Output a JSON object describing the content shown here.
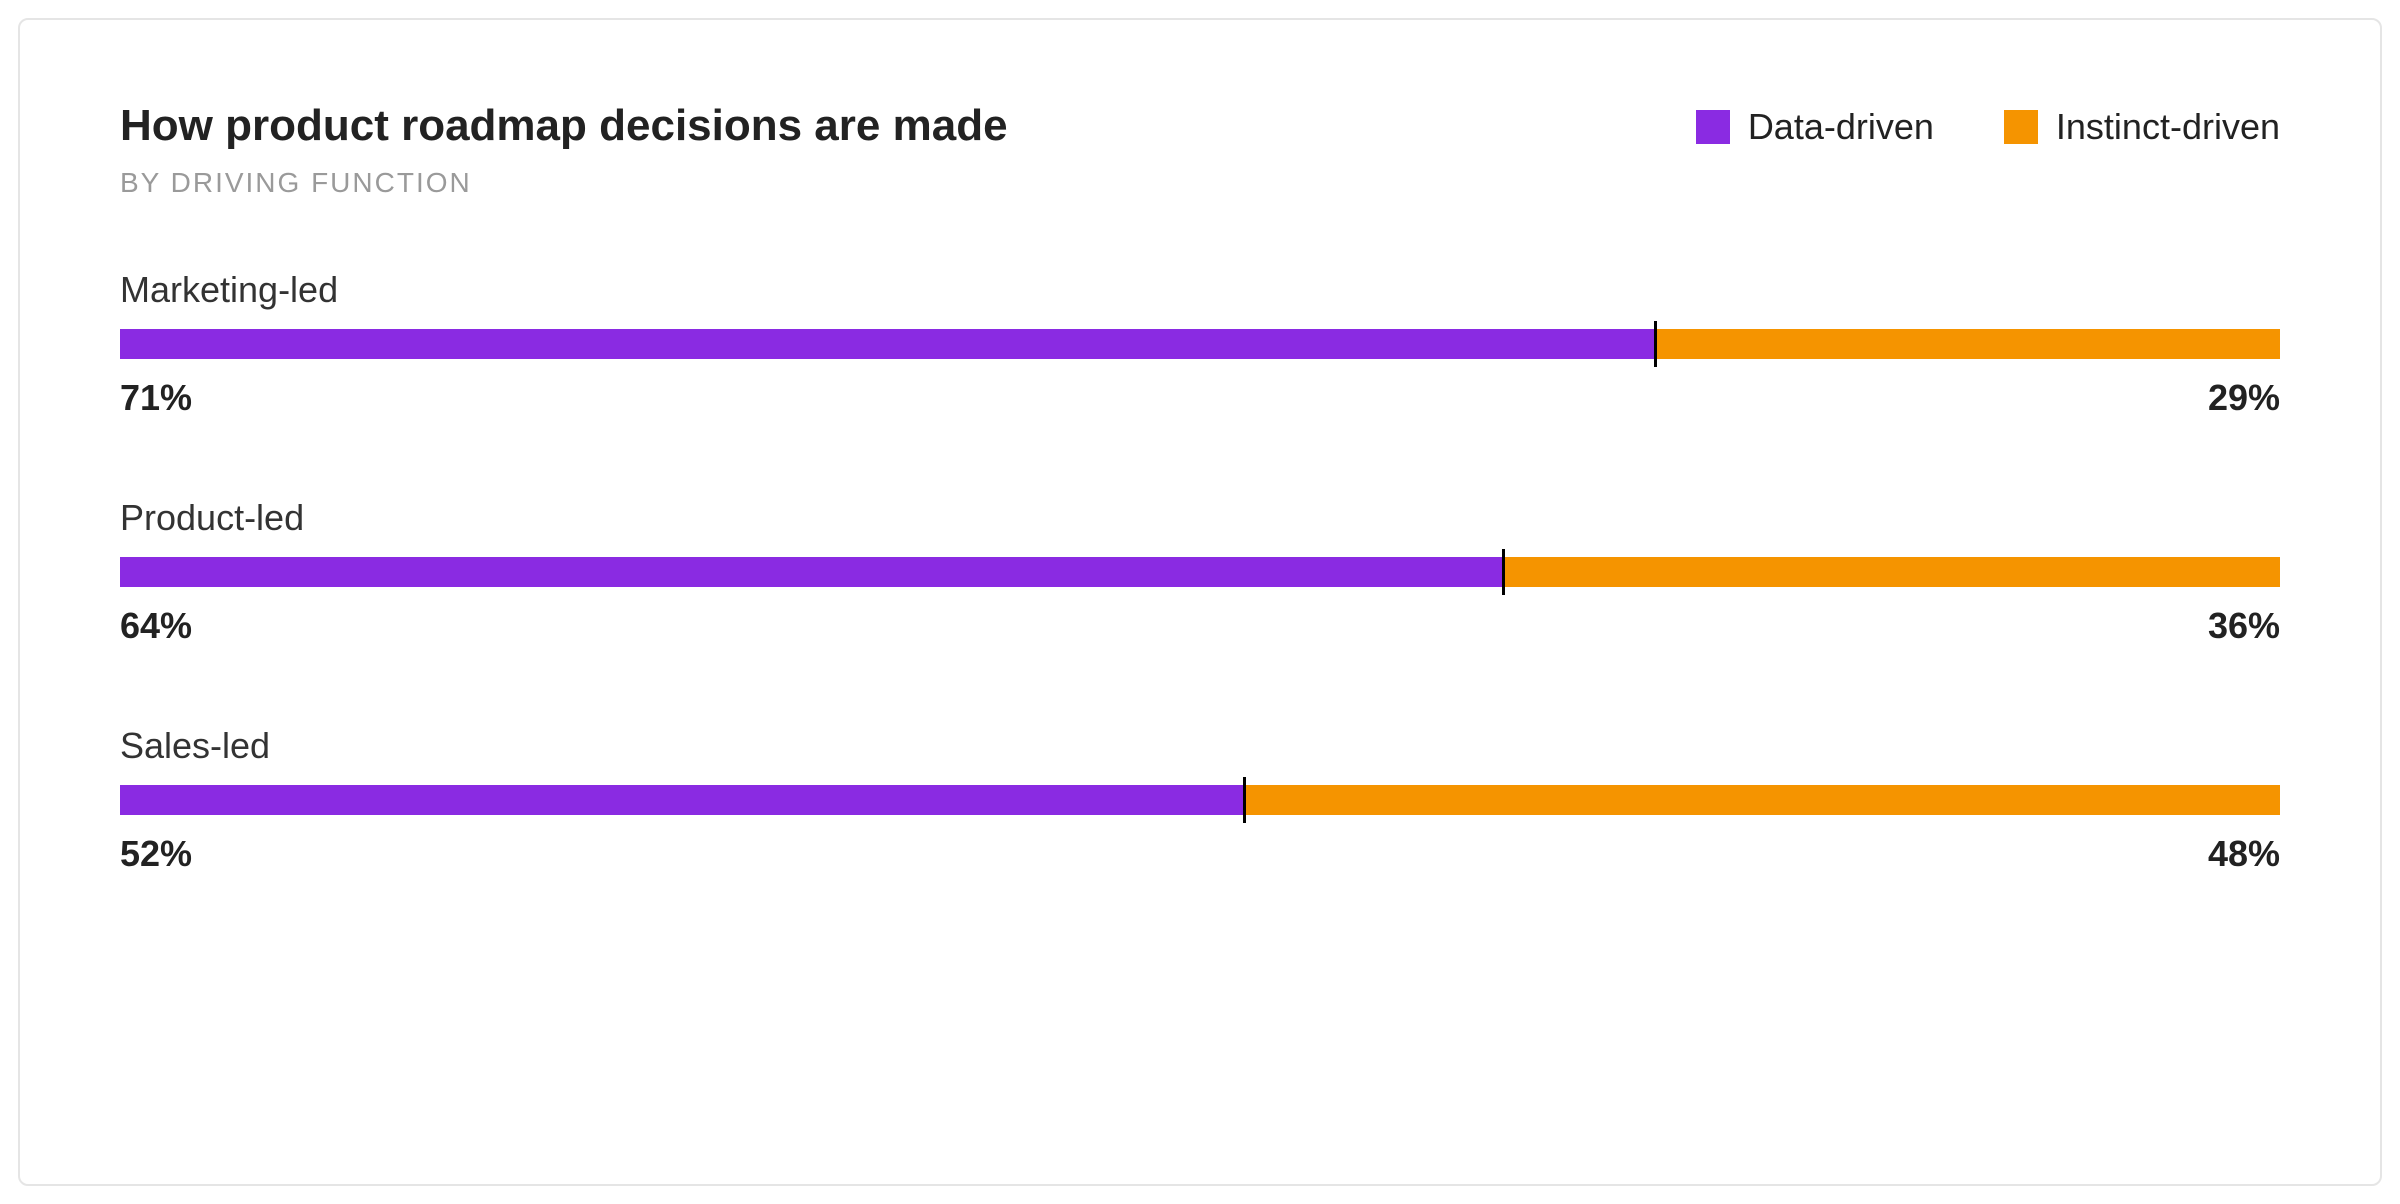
{
  "title": "How product roadmap decisions are made",
  "subtitle": "BY DRIVING FUNCTION",
  "legend": {
    "series_a": "Data-driven",
    "series_b": "Instinct-driven"
  },
  "colors": {
    "series_a": "#8A2BE2",
    "series_b": "#F59400",
    "divider": "#000000"
  },
  "chart_data": {
    "type": "bar",
    "stacked": true,
    "orientation": "horizontal",
    "unit": "%",
    "categories": [
      "Marketing-led",
      "Product-led",
      "Sales-led"
    ],
    "series": [
      {
        "name": "Data-driven",
        "values": [
          71,
          64,
          52
        ]
      },
      {
        "name": "Instinct-driven",
        "values": [
          29,
          36,
          48
        ]
      }
    ],
    "xlim": [
      0,
      100
    ]
  }
}
